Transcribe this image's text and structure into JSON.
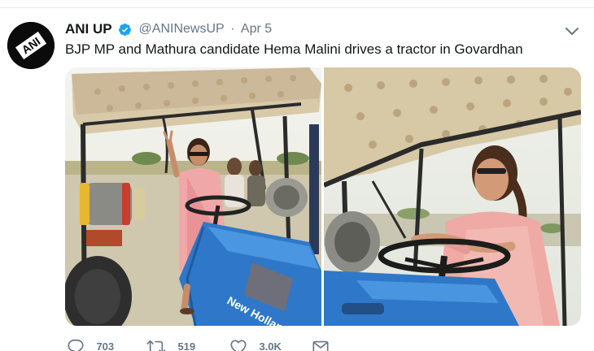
{
  "tweet": {
    "author_name": "ANI UP",
    "handle": "@ANINewsUP",
    "separator": "·",
    "date": "Apr 5",
    "text": "BJP MP and Mathura candidate Hema Malini drives a tractor in Govardhan",
    "avatar_text": "ANI",
    "tractor_model": "New Holland"
  },
  "actions": {
    "reply_count": "703",
    "retweet_count": "519",
    "like_count": "3.0K"
  },
  "icons": {
    "verified": "verified-badge-icon",
    "caret": "chevron-down-icon",
    "reply": "reply-icon",
    "retweet": "retweet-icon",
    "like": "heart-icon",
    "dm": "envelope-icon"
  },
  "colors": {
    "text_primary": "#14171a",
    "text_secondary": "#657786",
    "verified_blue": "#1da1f2",
    "divider": "#e6ecf0"
  }
}
